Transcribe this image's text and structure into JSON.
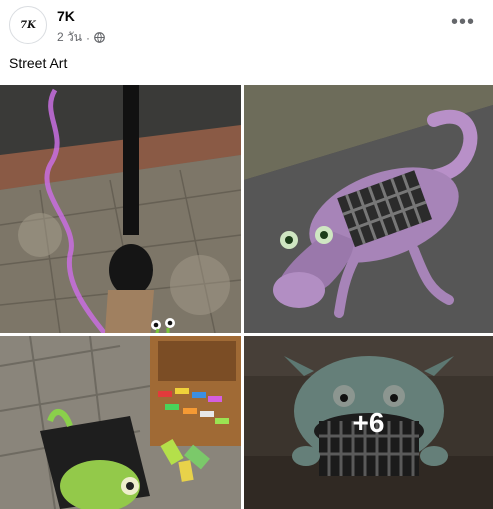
{
  "post": {
    "page_name": "7K",
    "avatar_text": "7K",
    "timestamp": "2 วัน",
    "separator": "·",
    "privacy_icon": "globe-icon",
    "more_icon": "more-horizontal-icon",
    "more_label": "•••",
    "caption": "Street Art"
  },
  "photos": {
    "items": [
      {
        "subject": "chalk art paintbrush lamp post with green alien"
      },
      {
        "subject": "chalk art crocodile on storm drain"
      },
      {
        "subject": "chalk art green creature in hole with chalk box"
      },
      {
        "subject": "chalk art monster eating storm drain"
      }
    ],
    "more_count": "+6"
  },
  "colors": {
    "name_text": "#050505",
    "meta_text": "#65676b",
    "overlay": "rgba(0,0,0,0.35)"
  }
}
